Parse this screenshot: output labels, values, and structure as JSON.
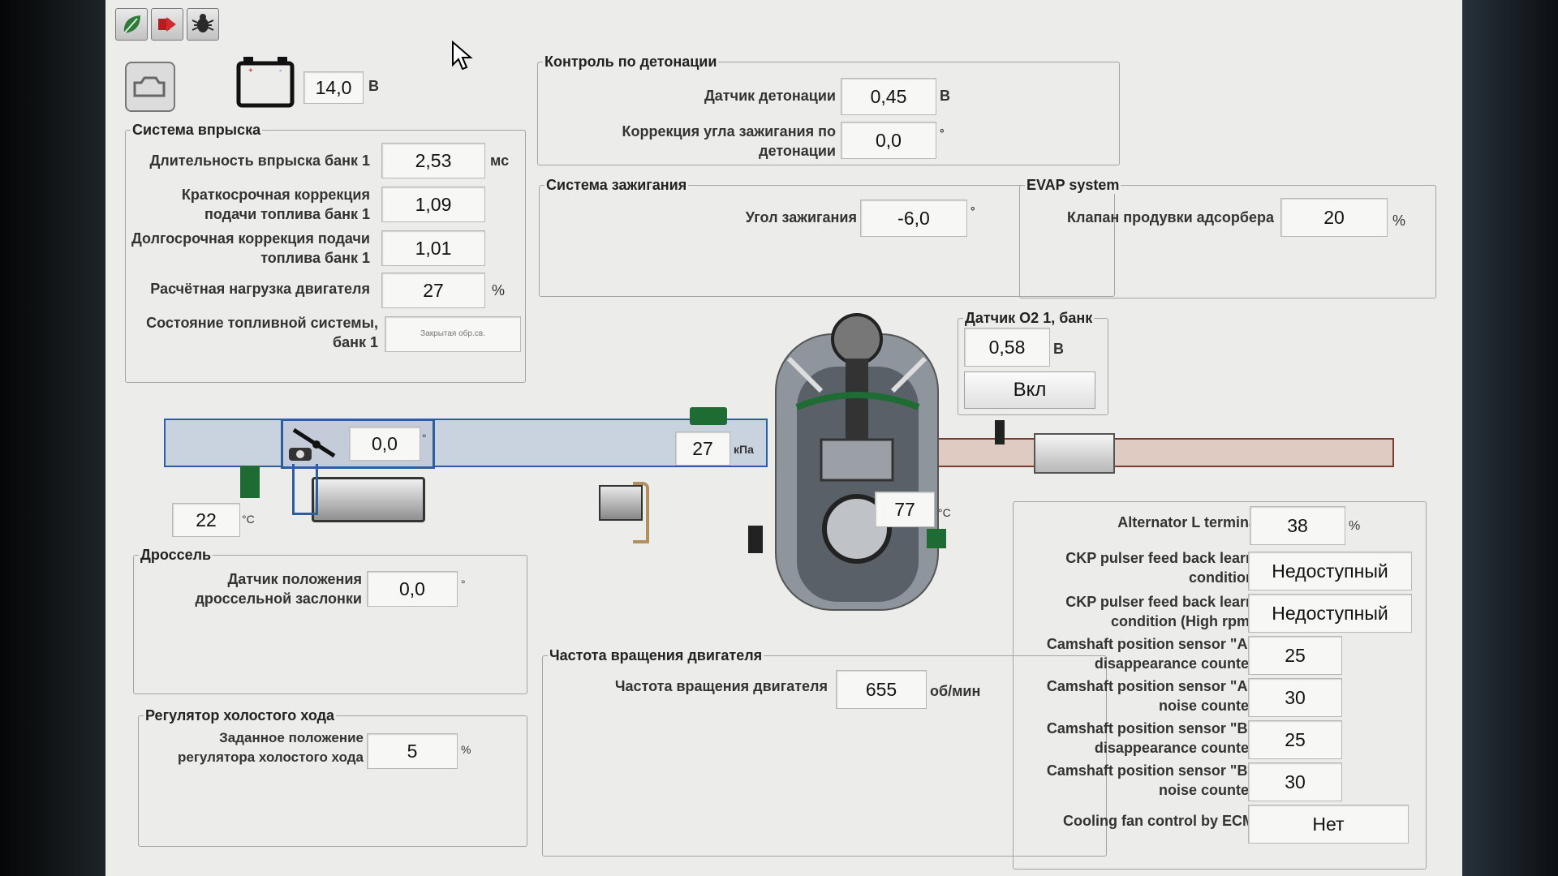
{
  "battery": {
    "value": "14,0",
    "unit": "В"
  },
  "injection": {
    "title": "Система впрыска",
    "rows": [
      {
        "label": "Длительность впрыска банк 1",
        "value": "2,53",
        "unit": "мс"
      },
      {
        "label": "Краткосрочная коррекция подачи топлива банк 1",
        "value": "1,09",
        "unit": ""
      },
      {
        "label": "Долгосрочная коррекция подачи топлива банк 1",
        "value": "1,01",
        "unit": ""
      },
      {
        "label": "Расчётная нагрузка двигателя",
        "value": "27",
        "unit": "%"
      },
      {
        "label": "Состояние топливной системы, банк 1",
        "value": "Закрытая обр.св.",
        "unit": ""
      }
    ]
  },
  "knock": {
    "title": "Контроль по детонации",
    "sensor_label": "Датчик детонации",
    "sensor_value": "0,45",
    "sensor_unit": "В",
    "correction_label": "Коррекция угла зажигания по детонации",
    "correction_value": "0,0",
    "correction_unit": "°"
  },
  "ignition": {
    "title": "Система зажигания",
    "angle_label": "Угол зажигания",
    "angle_value": "-6,0",
    "angle_unit": "°"
  },
  "evap": {
    "title": "EVAP system",
    "purge_label": "Клапан продувки адсорбера",
    "purge_value": "20",
    "purge_unit": "%"
  },
  "o2": {
    "title": "Датчик O2 1, банк",
    "value": "0,58",
    "unit": "В",
    "state": "Вкл"
  },
  "diagram": {
    "throttle_value": "0,0",
    "throttle_unit": "°",
    "map_value": "27",
    "map_unit": "кПа",
    "intake_temp": "22",
    "intake_temp_unit": "°C",
    "coolant_temp": "77",
    "coolant_temp_unit": "°C"
  },
  "throttle": {
    "title": "Дроссель",
    "tps_label": "Датчик положения дроссельной заслонки",
    "tps_value": "0,0",
    "tps_unit": "°"
  },
  "idle": {
    "title": "Регулятор холостого хода",
    "label": "Заданное положение регулятора холостого хода",
    "value": "5",
    "unit": "%"
  },
  "rpm": {
    "title": "Частота вращения двигателя",
    "label": "Частота вращения двигателя",
    "value": "655",
    "unit": "об/мин"
  },
  "extra": {
    "rows": [
      {
        "label": "Alternator L terminal",
        "value": "38",
        "unit": "%"
      },
      {
        "label": "CKP pulser feed back learn condition",
        "value": "Недоступный",
        "unit": ""
      },
      {
        "label": "CKP pulser feed back learn condition (High rpm)",
        "value": "Недоступный",
        "unit": ""
      },
      {
        "label": "Camshaft position sensor \"A\" disappearance counter",
        "value": "25",
        "unit": ""
      },
      {
        "label": "Camshaft position sensor \"A\" noise counter",
        "value": "30",
        "unit": ""
      },
      {
        "label": "Camshaft position sensor \"B\" disappearance counter",
        "value": "25",
        "unit": ""
      },
      {
        "label": "Camshaft position sensor \"B\" noise counter",
        "value": "30",
        "unit": ""
      },
      {
        "label": "Cooling fan control by ECM",
        "value": "Нет",
        "unit": ""
      }
    ]
  },
  "toolbar": {
    "icons": [
      "leaf-icon",
      "arrow-exit-icon",
      "bug-icon"
    ]
  },
  "colors": {
    "intake": "#c8d4e2",
    "exhaust": "#e4c4b8",
    "sensor_green": "#1e6b33"
  }
}
